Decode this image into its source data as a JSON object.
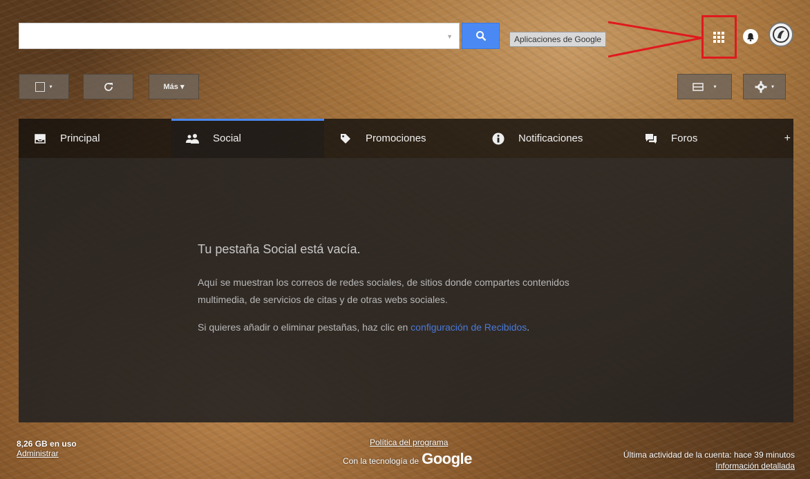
{
  "search": {
    "value": "",
    "placeholder": ""
  },
  "header": {
    "apps_tooltip": "Aplicaciones de Google",
    "accent_color": "#4a89f3",
    "highlight_color": "#e0191e"
  },
  "toolbar": {
    "select_caret": "▾",
    "more_label": "Más ▾",
    "density_caret": "▾",
    "settings_caret": "▾"
  },
  "tabs": [
    {
      "label": "Principal",
      "icon": "inbox-icon"
    },
    {
      "label": "Social",
      "icon": "people-icon"
    },
    {
      "label": "Promociones",
      "icon": "tag-icon"
    },
    {
      "label": "Notificaciones",
      "icon": "info-icon"
    },
    {
      "label": "Foros",
      "icon": "chat-icon"
    }
  ],
  "add_tab": "+",
  "empty_state": {
    "title": "Tu pestaña Social está vacía.",
    "description": "Aquí se muestran los correos de redes sociales, de sitios donde compartes contenidos multimedia, de servicios de citas y de otras webs sociales.",
    "hint_prefix": "Si quieres añadir o eliminar pestañas, haz clic en ",
    "hint_link": "configuración de Recibidos",
    "hint_suffix": "."
  },
  "footer": {
    "storage": "8,26 GB en uso",
    "manage": "Administrar",
    "policy": "Política del programa",
    "powered_prefix": "Con la tecnología de",
    "google_word": "Google",
    "last_activity": "Última actividad de la cuenta: hace 39 minutos",
    "details": "Información detallada"
  }
}
